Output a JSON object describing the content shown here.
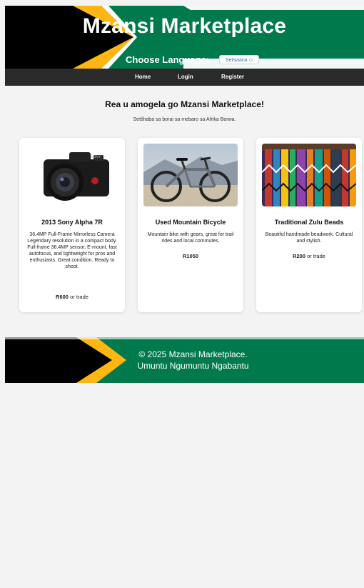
{
  "header": {
    "title": "Mzansi Marketplace",
    "language_label": "Choose Language:",
    "language_selected": "Setswana ◇"
  },
  "nav": {
    "home": "Home",
    "login": "Login",
    "register": "Register"
  },
  "main": {
    "welcome": "Rea u amogela go Mzansi Marketplace!",
    "subtitle": "Setšhaba sa borai sa mebaro sa Afrika Borwa."
  },
  "listings": [
    {
      "title": "2013 Sony Alpha 7R",
      "description": "36.4MP Full-Frame Mirrorless Camera Legendary resolution in a compact body. Full-frame 36.4MP sensor, E-mount, fast autofocus, and lightweight for pros and enthusiasts. Great condition. Ready to shoot.",
      "price": "R600",
      "trade": "or trade"
    },
    {
      "title": "Used Mountain Bicycle",
      "description": "Mountain bike with gears, great for trail rides and local commutes.",
      "price": "R1050",
      "trade": ""
    },
    {
      "title": "Traditional Zulu Beads",
      "description": "Beautiful handmade beadwork. Cultural and stylish.",
      "price": "R200",
      "trade": "or trade"
    }
  ],
  "footer": {
    "copyright": "© 2025 Mzansi Marketplace.",
    "motto": "Umuntu Ngumuntu Ngabantu"
  },
  "colors": {
    "green": "#007a4d",
    "gold": "#ffb612",
    "black": "#000000",
    "nav": "#2a2a2a"
  }
}
